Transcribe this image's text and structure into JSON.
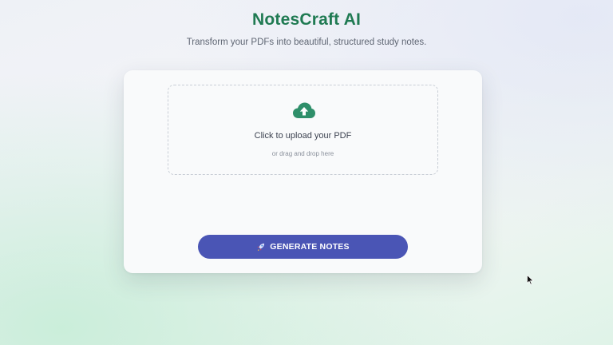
{
  "header": {
    "title": "NotesCraft AI",
    "subtitle": "Transform your PDFs into beautiful, structured study notes."
  },
  "upload": {
    "icon": "cloud-upload-icon",
    "label": "Click to upload your PDF",
    "hint": "or drag and drop here"
  },
  "actions": {
    "generate_icon": "rocket-icon",
    "generate_label": "GENERATE NOTES"
  },
  "colors": {
    "brand": "#1f7a52",
    "button": "#4a55b5",
    "upload_icon": "#2f8f6a"
  }
}
